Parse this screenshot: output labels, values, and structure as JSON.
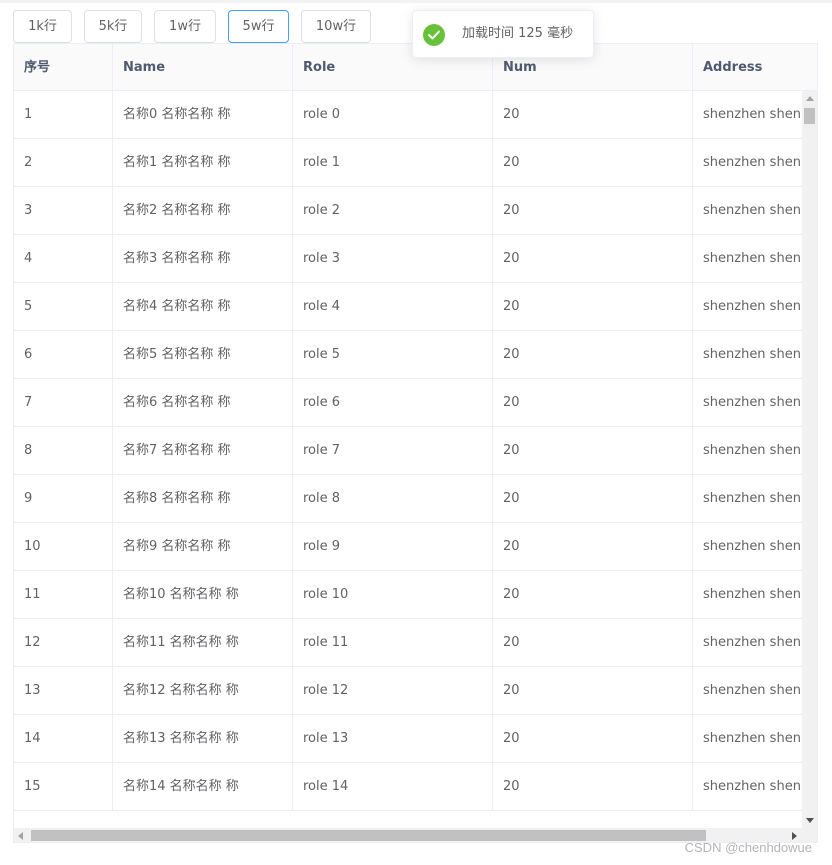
{
  "toolbar": {
    "buttons": [
      {
        "label": "1k行"
      },
      {
        "label": "5k行"
      },
      {
        "label": "1w行"
      },
      {
        "label": "5w行"
      },
      {
        "label": "10w行"
      }
    ],
    "active_index": 3
  },
  "toast": {
    "message": "加载时间 125 毫秒",
    "icon": "check-circle-icon",
    "color": "#67c23a"
  },
  "table": {
    "columns": [
      "序号",
      "Name",
      "Role",
      "Num",
      "Address"
    ],
    "rows": [
      [
        "1",
        "名称0 名称名称 称",
        "role 0",
        "20",
        "shenzhen shen"
      ],
      [
        "2",
        "名称1 名称名称 称",
        "role 1",
        "20",
        "shenzhen shen"
      ],
      [
        "3",
        "名称2 名称名称 称",
        "role 2",
        "20",
        "shenzhen shen"
      ],
      [
        "4",
        "名称3 名称名称 称",
        "role 3",
        "20",
        "shenzhen shen"
      ],
      [
        "5",
        "名称4 名称名称 称",
        "role 4",
        "20",
        "shenzhen shen"
      ],
      [
        "6",
        "名称5 名称名称 称",
        "role 5",
        "20",
        "shenzhen shen"
      ],
      [
        "7",
        "名称6 名称名称 称",
        "role 6",
        "20",
        "shenzhen shen"
      ],
      [
        "8",
        "名称7 名称名称 称",
        "role 7",
        "20",
        "shenzhen shen"
      ],
      [
        "9",
        "名称8 名称名称 称",
        "role 8",
        "20",
        "shenzhen shen"
      ],
      [
        "10",
        "名称9 名称名称 称",
        "role 9",
        "20",
        "shenzhen shen"
      ],
      [
        "11",
        "名称10 名称名称 称",
        "role 10",
        "20",
        "shenzhen shen"
      ],
      [
        "12",
        "名称11 名称名称 称",
        "role 11",
        "20",
        "shenzhen shen"
      ],
      [
        "13",
        "名称12 名称名称 称",
        "role 12",
        "20",
        "shenzhen shen"
      ],
      [
        "14",
        "名称13 名称名称 称",
        "role 13",
        "20",
        "shenzhen shen"
      ],
      [
        "15",
        "名称14 名称名称 称",
        "role 14",
        "20",
        "shenzhen shen"
      ]
    ]
  },
  "colors": {
    "accent": "#409eff",
    "success": "#67c23a",
    "border": "#ebeef5"
  },
  "watermark": "CSDN @chenhdowue"
}
